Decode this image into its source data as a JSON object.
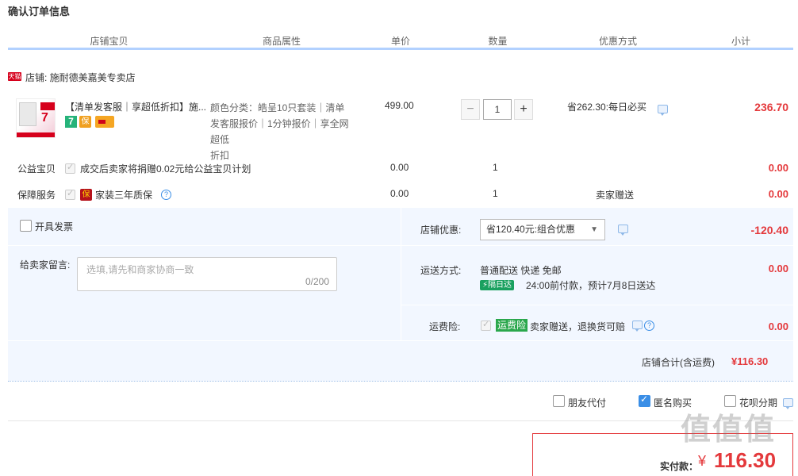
{
  "page_title": "确认订单信息",
  "columns": [
    "店铺宝贝",
    "商品属性",
    "单价",
    "数量",
    "优惠方式",
    "小计"
  ],
  "shop": {
    "badge": "天猫",
    "label": "店铺: 施耐德美嘉美专卖店"
  },
  "product": {
    "name": "【清单发客服｜享超低折扣】施...",
    "attr_line1": "颜色分类：皓呈10只套装｜清单",
    "attr_line2": "发客服报价｜1分钟报价｜享全网超低",
    "attr_line3": "折扣",
    "price": "499.00",
    "quantity": "1",
    "discount": "省262.30:每日必买",
    "subtotal": "236.70",
    "thumb_text": "7",
    "minus_label": "−",
    "plus_label": "+",
    "badge_7": "7",
    "badge_bao": "保"
  },
  "charity": {
    "label": "公益宝贝",
    "text": "成交后卖家将捐赠0.02元给公益宝贝计划",
    "price": "0.00",
    "quantity": "1",
    "subtotal": "0.00"
  },
  "warranty": {
    "label": "保障服务",
    "badge": "保",
    "text": "家装三年质保",
    "price": "0.00",
    "quantity": "1",
    "discount": "卖家赠送",
    "subtotal": "0.00"
  },
  "invoice": {
    "label": "开具发票"
  },
  "message": {
    "label": "给卖家留言:",
    "placeholder": "选填,请先和商家协商一致",
    "counter": "0/200"
  },
  "shop_discount": {
    "label": "店铺优惠:",
    "selected": "省120.40元:组合优惠",
    "amount": "-120.40"
  },
  "shipping": {
    "label": "运送方式:",
    "method": "普通配送 快递 免邮",
    "tag": "隔日达",
    "note": "24:00前付款，预计7月8日送达",
    "amount": "0.00"
  },
  "insurance": {
    "label": "运费险:",
    "tag": "运费险",
    "text": "卖家赠送，退换货可赔",
    "amount": "0.00"
  },
  "shop_total": {
    "label": "店铺合计(含运费)",
    "amount": "¥116.30"
  },
  "options": {
    "friend_pay": "朋友代付",
    "anonymous": "匿名购买",
    "huabei": "花呗分期"
  },
  "pay": {
    "label": "实付款：",
    "currency": "¥",
    "amount": "116.30"
  },
  "watermark": "值值值",
  "colors": {
    "accent_red": "#e4393c",
    "header_line": "#b2d1ff",
    "panel_bg": "#f2f7ff",
    "tag_green": "#19a05f"
  }
}
